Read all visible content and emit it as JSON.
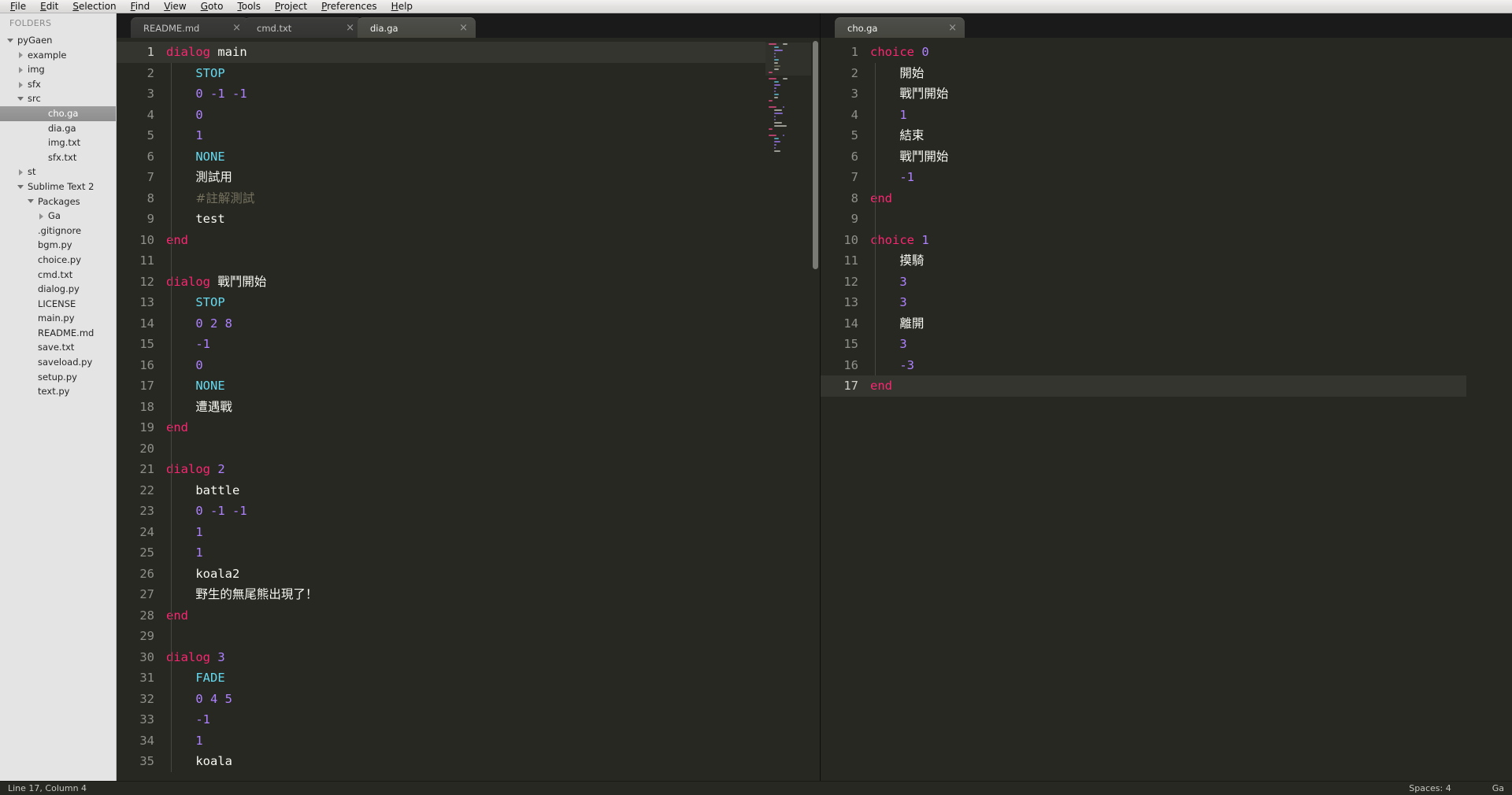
{
  "menu": {
    "items": [
      {
        "label": "File",
        "mnemonic": "F"
      },
      {
        "label": "Edit",
        "mnemonic": "E"
      },
      {
        "label": "Selection",
        "mnemonic": "S"
      },
      {
        "label": "Find",
        "mnemonic": "F"
      },
      {
        "label": "View",
        "mnemonic": "V"
      },
      {
        "label": "Goto",
        "mnemonic": "G"
      },
      {
        "label": "Tools",
        "mnemonic": "T"
      },
      {
        "label": "Project",
        "mnemonic": "P"
      },
      {
        "label": "Preferences",
        "mnemonic": "P"
      },
      {
        "label": "Help",
        "mnemonic": "H"
      }
    ]
  },
  "sidebar": {
    "title": "FOLDERS",
    "items": [
      {
        "label": "pyGaen",
        "indent": 0,
        "state": "open",
        "selected": false,
        "bold": false
      },
      {
        "label": "example",
        "indent": 1,
        "state": "closed",
        "selected": false,
        "bold": false
      },
      {
        "label": "img",
        "indent": 1,
        "state": "closed",
        "selected": false,
        "bold": false
      },
      {
        "label": "sfx",
        "indent": 1,
        "state": "closed",
        "selected": false,
        "bold": false
      },
      {
        "label": "src",
        "indent": 1,
        "state": "open",
        "selected": false,
        "bold": false
      },
      {
        "label": "cho.ga",
        "indent": 3,
        "state": "none",
        "selected": true,
        "bold": false
      },
      {
        "label": "dia.ga",
        "indent": 3,
        "state": "none",
        "selected": false,
        "bold": false
      },
      {
        "label": "img.txt",
        "indent": 3,
        "state": "none",
        "selected": false,
        "bold": false
      },
      {
        "label": "sfx.txt",
        "indent": 3,
        "state": "none",
        "selected": false,
        "bold": false
      },
      {
        "label": "st",
        "indent": 1,
        "state": "closed",
        "selected": false,
        "bold": false
      },
      {
        "label": "Sublime Text 2",
        "indent": 1,
        "state": "open",
        "selected": false,
        "bold": false
      },
      {
        "label": "Packages",
        "indent": 2,
        "state": "open",
        "selected": false,
        "bold": false
      },
      {
        "label": "Ga",
        "indent": 3,
        "state": "closed",
        "selected": false,
        "bold": false
      },
      {
        "label": ".gitignore",
        "indent": 2,
        "state": "none",
        "selected": false,
        "bold": false
      },
      {
        "label": "bgm.py",
        "indent": 2,
        "state": "none",
        "selected": false,
        "bold": false
      },
      {
        "label": "choice.py",
        "indent": 2,
        "state": "none",
        "selected": false,
        "bold": false
      },
      {
        "label": "cmd.txt",
        "indent": 2,
        "state": "none",
        "selected": false,
        "bold": false
      },
      {
        "label": "dialog.py",
        "indent": 2,
        "state": "none",
        "selected": false,
        "bold": false
      },
      {
        "label": "LICENSE",
        "indent": 2,
        "state": "none",
        "selected": false,
        "bold": false
      },
      {
        "label": "main.py",
        "indent": 2,
        "state": "none",
        "selected": false,
        "bold": false
      },
      {
        "label": "README.md",
        "indent": 2,
        "state": "none",
        "selected": false,
        "bold": false
      },
      {
        "label": "save.txt",
        "indent": 2,
        "state": "none",
        "selected": false,
        "bold": false
      },
      {
        "label": "saveload.py",
        "indent": 2,
        "state": "none",
        "selected": false,
        "bold": false
      },
      {
        "label": "setup.py",
        "indent": 2,
        "state": "none",
        "selected": false,
        "bold": false
      },
      {
        "label": "text.py",
        "indent": 2,
        "state": "none",
        "selected": false,
        "bold": false
      }
    ]
  },
  "panes": {
    "left": {
      "tabs": [
        {
          "label": "README.md",
          "active": false,
          "close": "×"
        },
        {
          "label": "cmd.txt",
          "active": false,
          "close": "×"
        },
        {
          "label": "dia.ga",
          "active": true,
          "close": "×"
        }
      ],
      "current_line": 1,
      "lines": [
        {
          "n": 1,
          "tokens": [
            {
              "t": "dialog",
              "c": "kw"
            },
            {
              "t": " ",
              "c": "txt"
            },
            {
              "t": "main",
              "c": "txt"
            }
          ]
        },
        {
          "n": 2,
          "tokens": [
            {
              "t": "    ",
              "c": "txt"
            },
            {
              "t": "STOP",
              "c": "fn"
            }
          ]
        },
        {
          "n": 3,
          "tokens": [
            {
              "t": "    ",
              "c": "txt"
            },
            {
              "t": "0 -1 -1",
              "c": "num"
            }
          ]
        },
        {
          "n": 4,
          "tokens": [
            {
              "t": "    ",
              "c": "txt"
            },
            {
              "t": "0",
              "c": "num"
            }
          ]
        },
        {
          "n": 5,
          "tokens": [
            {
              "t": "    ",
              "c": "txt"
            },
            {
              "t": "1",
              "c": "num"
            }
          ]
        },
        {
          "n": 6,
          "tokens": [
            {
              "t": "    ",
              "c": "txt"
            },
            {
              "t": "NONE",
              "c": "fn"
            }
          ]
        },
        {
          "n": 7,
          "tokens": [
            {
              "t": "    ",
              "c": "txt"
            },
            {
              "t": "測試用",
              "c": "txt cjk"
            }
          ]
        },
        {
          "n": 8,
          "tokens": [
            {
              "t": "    ",
              "c": "txt"
            },
            {
              "t": "#註解測試",
              "c": "cmt cjk"
            }
          ]
        },
        {
          "n": 9,
          "tokens": [
            {
              "t": "    ",
              "c": "txt"
            },
            {
              "t": "test",
              "c": "txt"
            }
          ]
        },
        {
          "n": 10,
          "tokens": [
            {
              "t": "end",
              "c": "kw"
            }
          ]
        },
        {
          "n": 11,
          "tokens": []
        },
        {
          "n": 12,
          "tokens": [
            {
              "t": "dialog",
              "c": "kw"
            },
            {
              "t": " ",
              "c": "txt"
            },
            {
              "t": "戰鬥開始",
              "c": "txt cjk"
            }
          ]
        },
        {
          "n": 13,
          "tokens": [
            {
              "t": "    ",
              "c": "txt"
            },
            {
              "t": "STOP",
              "c": "fn"
            }
          ]
        },
        {
          "n": 14,
          "tokens": [
            {
              "t": "    ",
              "c": "txt"
            },
            {
              "t": "0 2 8",
              "c": "num"
            }
          ]
        },
        {
          "n": 15,
          "tokens": [
            {
              "t": "    ",
              "c": "txt"
            },
            {
              "t": "-1",
              "c": "num"
            }
          ]
        },
        {
          "n": 16,
          "tokens": [
            {
              "t": "    ",
              "c": "txt"
            },
            {
              "t": "0",
              "c": "num"
            }
          ]
        },
        {
          "n": 17,
          "tokens": [
            {
              "t": "    ",
              "c": "txt"
            },
            {
              "t": "NONE",
              "c": "fn"
            }
          ]
        },
        {
          "n": 18,
          "tokens": [
            {
              "t": "    ",
              "c": "txt"
            },
            {
              "t": "遭遇戰",
              "c": "txt cjk"
            }
          ]
        },
        {
          "n": 19,
          "tokens": [
            {
              "t": "end",
              "c": "kw"
            }
          ]
        },
        {
          "n": 20,
          "tokens": []
        },
        {
          "n": 21,
          "tokens": [
            {
              "t": "dialog",
              "c": "kw"
            },
            {
              "t": " ",
              "c": "txt"
            },
            {
              "t": "2",
              "c": "num"
            }
          ]
        },
        {
          "n": 22,
          "tokens": [
            {
              "t": "    ",
              "c": "txt"
            },
            {
              "t": "battle",
              "c": "txt"
            }
          ]
        },
        {
          "n": 23,
          "tokens": [
            {
              "t": "    ",
              "c": "txt"
            },
            {
              "t": "0 -1 -1",
              "c": "num"
            }
          ]
        },
        {
          "n": 24,
          "tokens": [
            {
              "t": "    ",
              "c": "txt"
            },
            {
              "t": "1",
              "c": "num"
            }
          ]
        },
        {
          "n": 25,
          "tokens": [
            {
              "t": "    ",
              "c": "txt"
            },
            {
              "t": "1",
              "c": "num"
            }
          ]
        },
        {
          "n": 26,
          "tokens": [
            {
              "t": "    ",
              "c": "txt"
            },
            {
              "t": "koala2",
              "c": "txt"
            }
          ]
        },
        {
          "n": 27,
          "tokens": [
            {
              "t": "    ",
              "c": "txt"
            },
            {
              "t": "野生的無尾熊出現了！",
              "c": "txt cjk"
            }
          ]
        },
        {
          "n": 28,
          "tokens": [
            {
              "t": "end",
              "c": "kw"
            }
          ]
        },
        {
          "n": 29,
          "tokens": []
        },
        {
          "n": 30,
          "tokens": [
            {
              "t": "dialog",
              "c": "kw"
            },
            {
              "t": " ",
              "c": "txt"
            },
            {
              "t": "3",
              "c": "num"
            }
          ]
        },
        {
          "n": 31,
          "tokens": [
            {
              "t": "    ",
              "c": "txt"
            },
            {
              "t": "FADE",
              "c": "fn"
            }
          ]
        },
        {
          "n": 32,
          "tokens": [
            {
              "t": "    ",
              "c": "txt"
            },
            {
              "t": "0 4 5",
              "c": "num"
            }
          ]
        },
        {
          "n": 33,
          "tokens": [
            {
              "t": "    ",
              "c": "txt"
            },
            {
              "t": "-1",
              "c": "num"
            }
          ]
        },
        {
          "n": 34,
          "tokens": [
            {
              "t": "    ",
              "c": "txt"
            },
            {
              "t": "1",
              "c": "num"
            }
          ]
        },
        {
          "n": 35,
          "tokens": [
            {
              "t": "    ",
              "c": "txt"
            },
            {
              "t": "koala",
              "c": "txt"
            }
          ]
        }
      ]
    },
    "right": {
      "tabs": [
        {
          "label": "cho.ga",
          "active": true,
          "close": "×"
        }
      ],
      "current_line": 17,
      "lines": [
        {
          "n": 1,
          "tokens": [
            {
              "t": "choice",
              "c": "kw"
            },
            {
              "t": " ",
              "c": "txt"
            },
            {
              "t": "0",
              "c": "num"
            }
          ]
        },
        {
          "n": 2,
          "tokens": [
            {
              "t": "    ",
              "c": "txt"
            },
            {
              "t": "開始",
              "c": "txt cjk"
            }
          ]
        },
        {
          "n": 3,
          "tokens": [
            {
              "t": "    ",
              "c": "txt"
            },
            {
              "t": "戰鬥開始",
              "c": "txt cjk"
            }
          ]
        },
        {
          "n": 4,
          "tokens": [
            {
              "t": "    ",
              "c": "txt"
            },
            {
              "t": "1",
              "c": "num"
            }
          ]
        },
        {
          "n": 5,
          "tokens": [
            {
              "t": "    ",
              "c": "txt"
            },
            {
              "t": "結束",
              "c": "txt cjk"
            }
          ]
        },
        {
          "n": 6,
          "tokens": [
            {
              "t": "    ",
              "c": "txt"
            },
            {
              "t": "戰鬥開始",
              "c": "txt cjk"
            }
          ]
        },
        {
          "n": 7,
          "tokens": [
            {
              "t": "    ",
              "c": "txt"
            },
            {
              "t": "-1",
              "c": "num"
            }
          ]
        },
        {
          "n": 8,
          "tokens": [
            {
              "t": "end",
              "c": "kw"
            }
          ]
        },
        {
          "n": 9,
          "tokens": []
        },
        {
          "n": 10,
          "tokens": [
            {
              "t": "choice",
              "c": "kw"
            },
            {
              "t": " ",
              "c": "txt"
            },
            {
              "t": "1",
              "c": "num"
            }
          ]
        },
        {
          "n": 11,
          "tokens": [
            {
              "t": "    ",
              "c": "txt"
            },
            {
              "t": "摸騎",
              "c": "txt cjk"
            }
          ]
        },
        {
          "n": 12,
          "tokens": [
            {
              "t": "    ",
              "c": "txt"
            },
            {
              "t": "3",
              "c": "num"
            }
          ]
        },
        {
          "n": 13,
          "tokens": [
            {
              "t": "    ",
              "c": "txt"
            },
            {
              "t": "3",
              "c": "num"
            }
          ]
        },
        {
          "n": 14,
          "tokens": [
            {
              "t": "    ",
              "c": "txt"
            },
            {
              "t": "離開",
              "c": "txt cjk"
            }
          ]
        },
        {
          "n": 15,
          "tokens": [
            {
              "t": "    ",
              "c": "txt"
            },
            {
              "t": "3",
              "c": "num"
            }
          ]
        },
        {
          "n": 16,
          "tokens": [
            {
              "t": "    ",
              "c": "txt"
            },
            {
              "t": "-3",
              "c": "num"
            }
          ]
        },
        {
          "n": 17,
          "tokens": [
            {
              "t": "end",
              "c": "kw"
            }
          ]
        }
      ]
    }
  },
  "statusbar": {
    "position": "Line 17, Column 4",
    "indentation": "Spaces: 4",
    "syntax": "Ga"
  },
  "colors": {
    "keyword": "#f92672",
    "function": "#66d9ef",
    "number": "#ae81ff",
    "text": "#f8f8f2",
    "comment": "#75715e",
    "editor_bg": "#272822",
    "sidebar_bg": "#e4e4e4",
    "selection_bg": "#9d9d9d"
  }
}
